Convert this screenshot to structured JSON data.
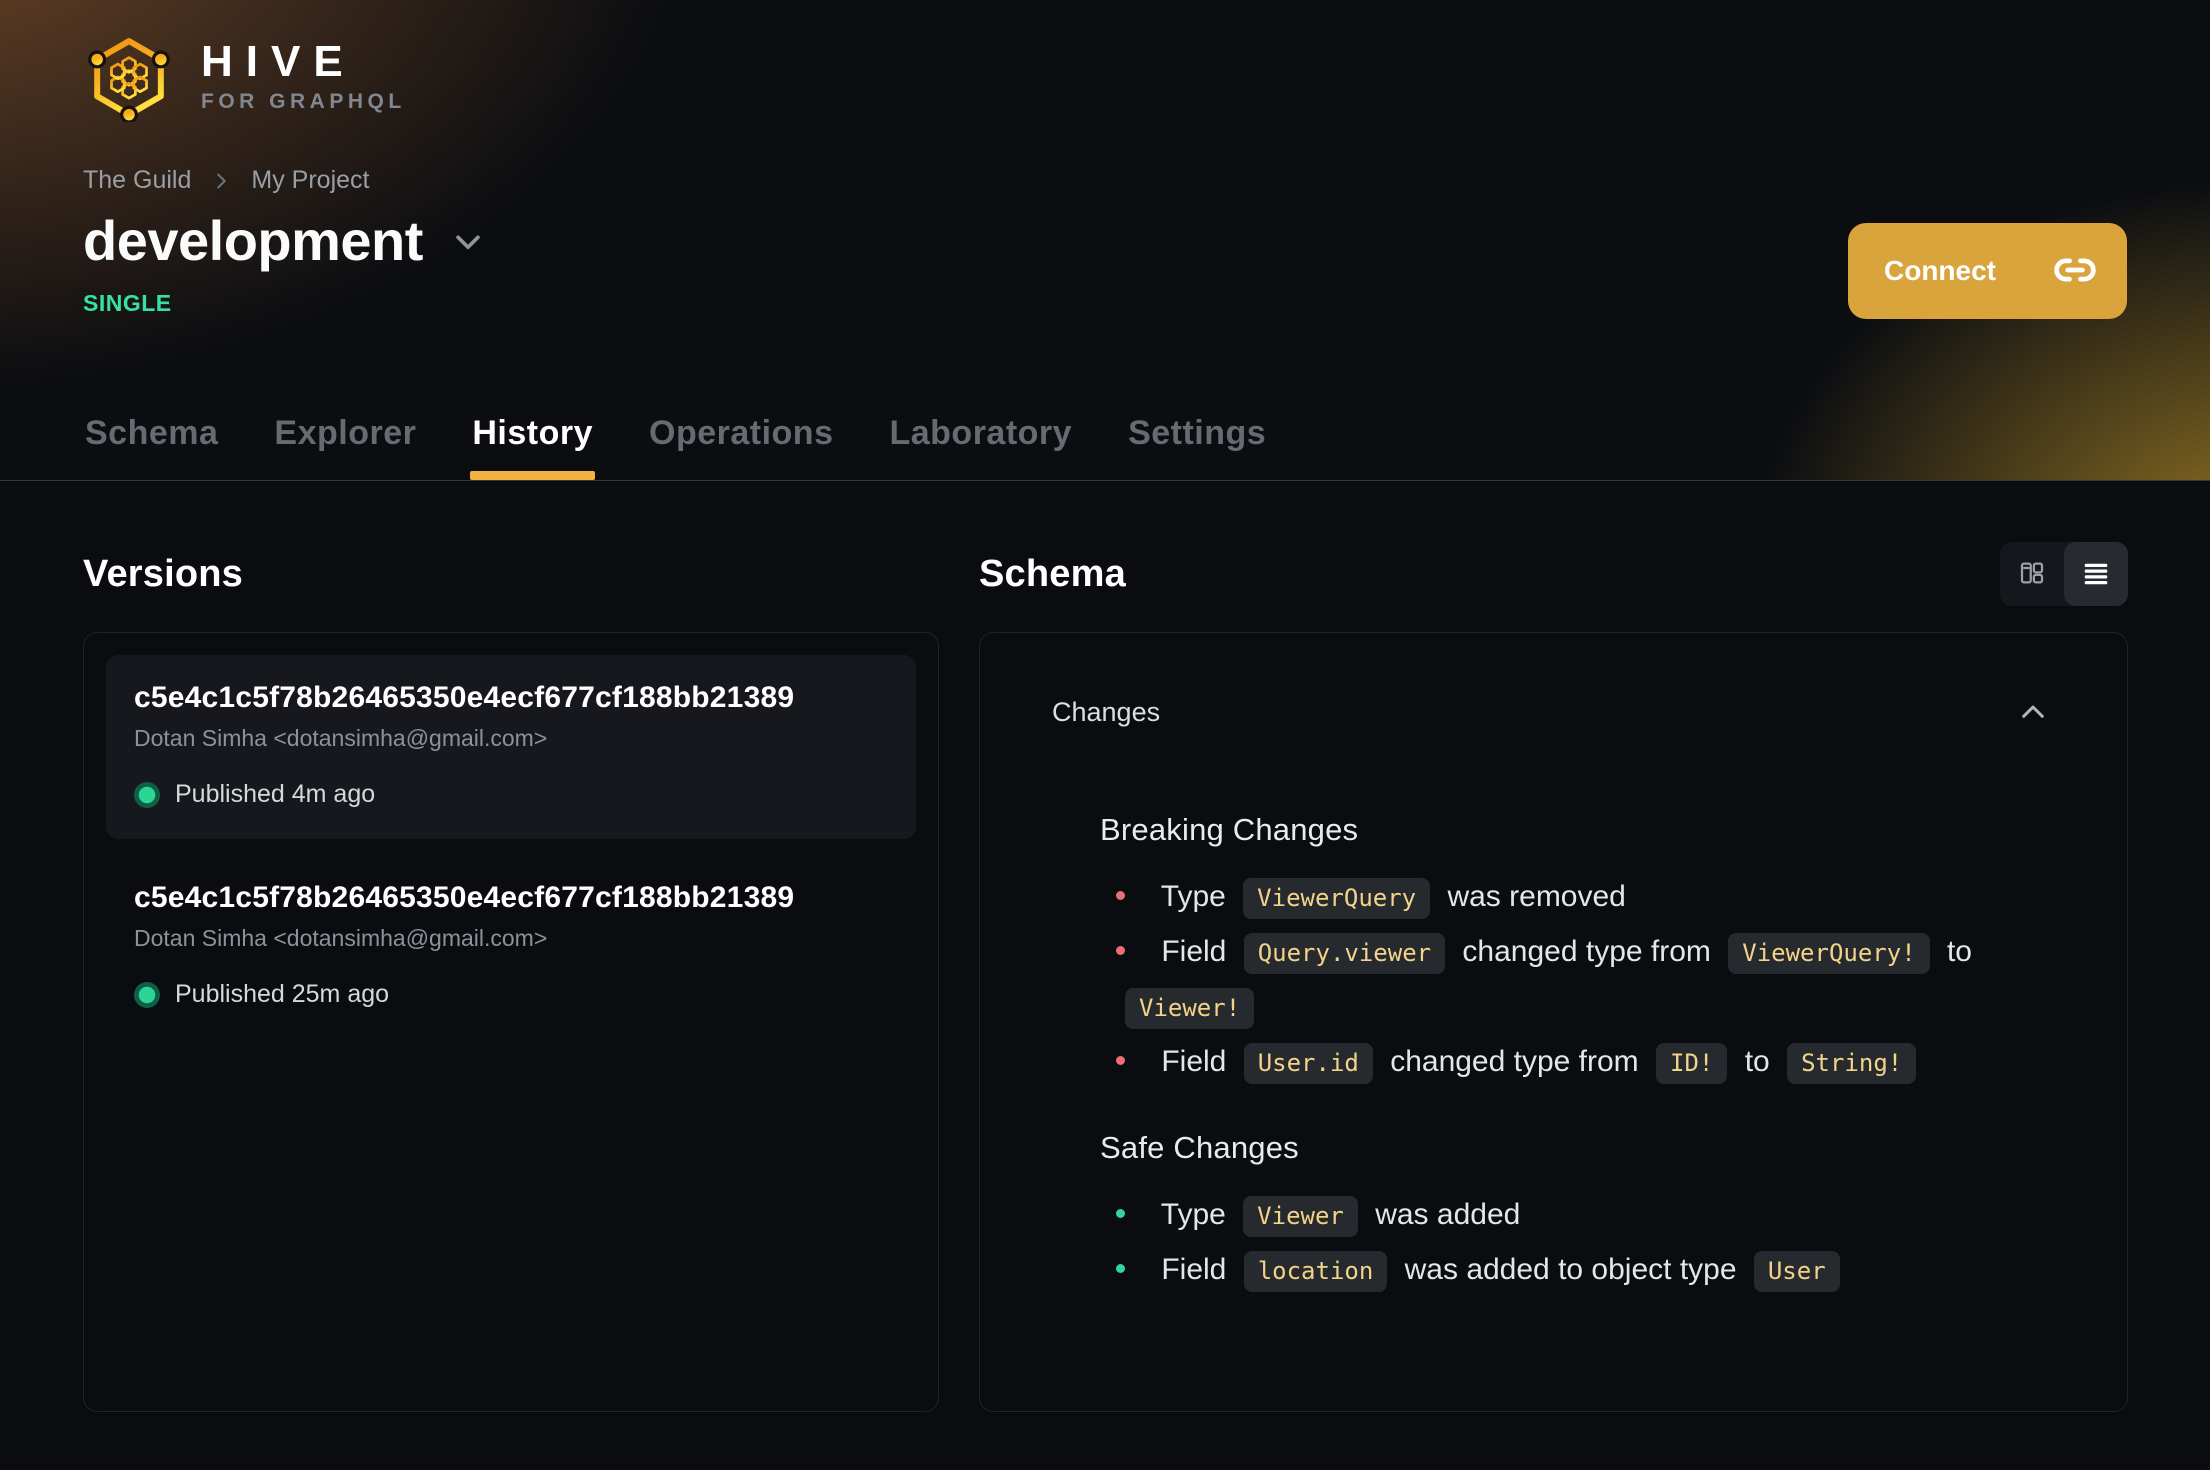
{
  "brand": {
    "name": "HIVE",
    "tagline": "FOR GRAPHQL"
  },
  "breadcrumb": {
    "org": "The Guild",
    "project": "My Project"
  },
  "project": {
    "title": "development",
    "badge": "SINGLE"
  },
  "connect": {
    "label": "Connect"
  },
  "tabs": [
    {
      "label": "Schema",
      "active": false
    },
    {
      "label": "Explorer",
      "active": false
    },
    {
      "label": "History",
      "active": true
    },
    {
      "label": "Operations",
      "active": false
    },
    {
      "label": "Laboratory",
      "active": false
    },
    {
      "label": "Settings",
      "active": false
    }
  ],
  "versions": {
    "heading": "Versions",
    "items": [
      {
        "hash": "c5e4c1c5f78b26465350e4ecf677cf188bb21389",
        "author": "Dotan Simha <dotansimha@gmail.com>",
        "status": "Published 4m ago",
        "selected": true
      },
      {
        "hash": "c5e4c1c5f78b26465350e4ecf677cf188bb21389",
        "author": "Dotan Simha <dotansimha@gmail.com>",
        "status": "Published 25m ago",
        "selected": false
      }
    ]
  },
  "schema_panel": {
    "heading": "Schema",
    "changes_label": "Changes",
    "sections": [
      {
        "title": "Breaking Changes",
        "kind": "breaking",
        "items": [
          {
            "segments": [
              {
                "t": "text",
                "v": "Type"
              },
              {
                "t": "code",
                "v": "ViewerQuery"
              },
              {
                "t": "text",
                "v": "was removed"
              }
            ]
          },
          {
            "segments": [
              {
                "t": "text",
                "v": "Field"
              },
              {
                "t": "code",
                "v": "Query.viewer"
              },
              {
                "t": "text",
                "v": "changed type from"
              },
              {
                "t": "code",
                "v": "ViewerQuery!"
              },
              {
                "t": "text",
                "v": "to"
              },
              {
                "t": "code",
                "v": "Viewer!"
              }
            ]
          },
          {
            "segments": [
              {
                "t": "text",
                "v": "Field"
              },
              {
                "t": "code",
                "v": "User.id"
              },
              {
                "t": "text",
                "v": "changed type from"
              },
              {
                "t": "code",
                "v": "ID!"
              },
              {
                "t": "text",
                "v": "to"
              },
              {
                "t": "code",
                "v": "String!"
              }
            ]
          }
        ]
      },
      {
        "title": "Safe Changes",
        "kind": "safe",
        "items": [
          {
            "segments": [
              {
                "t": "text",
                "v": "Type"
              },
              {
                "t": "code",
                "v": "Viewer"
              },
              {
                "t": "text",
                "v": "was added"
              }
            ]
          },
          {
            "segments": [
              {
                "t": "text",
                "v": "Field"
              },
              {
                "t": "code",
                "v": "location"
              },
              {
                "t": "text",
                "v": "was added to object type"
              },
              {
                "t": "code",
                "v": "User"
              }
            ]
          }
        ]
      }
    ]
  },
  "icons": {
    "logo": "hive-hexagon-honeycomb",
    "breadcrumb_separator": "chevron-right",
    "target_switcher": "chevron-down",
    "connect_button": "link",
    "view_toggle": [
      "columns-layout",
      "list-lines"
    ],
    "changes_collapse": "chevron-up",
    "published_status": "green-dot"
  },
  "colors": {
    "accent_amber": "#daa43d",
    "tab_underline": "#f0b342",
    "badge_green": "#35e2a2",
    "status_dot_green": "#2ed494",
    "breaking_bullet": "#ed6e78",
    "safe_bullet": "#33d39b",
    "code_text": "#f2d489",
    "code_bg": "#26292e",
    "page_bg": "#0a0c0f"
  }
}
